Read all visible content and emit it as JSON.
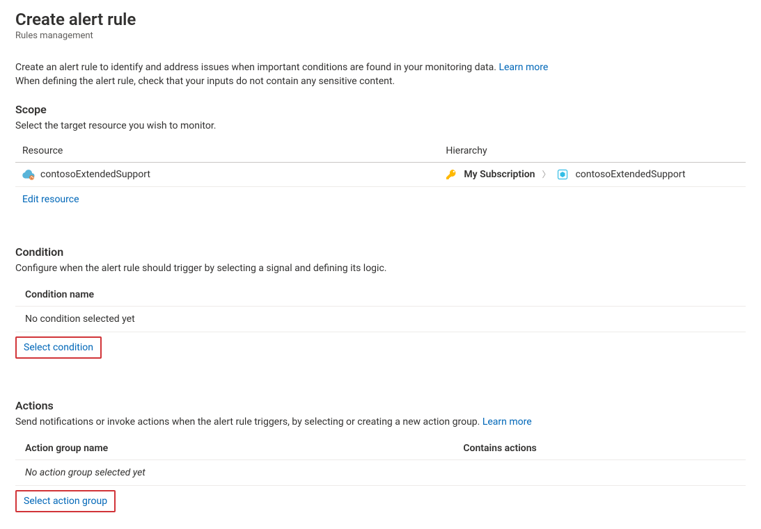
{
  "header": {
    "title": "Create alert rule",
    "subtitle": "Rules management"
  },
  "intro": {
    "line1_a": "Create an alert rule to identify and address issues when important conditions are found in your monitoring data. ",
    "learn_more": "Learn more",
    "line2": "When defining the alert rule, check that your inputs do not contain any sensitive content."
  },
  "scope": {
    "title": "Scope",
    "desc": "Select the target resource you wish to monitor.",
    "col_resource": "Resource",
    "col_hierarchy": "Hierarchy",
    "row": {
      "resource_name": "contosoExtendedSupport",
      "subscription": "My Subscription",
      "resource_group": "contosoExtendedSupport"
    },
    "edit_label": "Edit resource"
  },
  "condition": {
    "title": "Condition",
    "desc": "Configure when the alert rule should trigger by selecting a signal and defining its logic.",
    "col_name": "Condition name",
    "empty": "No condition selected yet",
    "select_label": "Select condition"
  },
  "actions": {
    "title": "Actions",
    "desc_prefix": "Send notifications or invoke actions when the alert rule triggers, by selecting or creating a new action group. ",
    "learn_more": "Learn more",
    "col_name": "Action group name",
    "col_contains": "Contains actions",
    "empty": "No action group selected yet",
    "select_label": "Select action group"
  }
}
